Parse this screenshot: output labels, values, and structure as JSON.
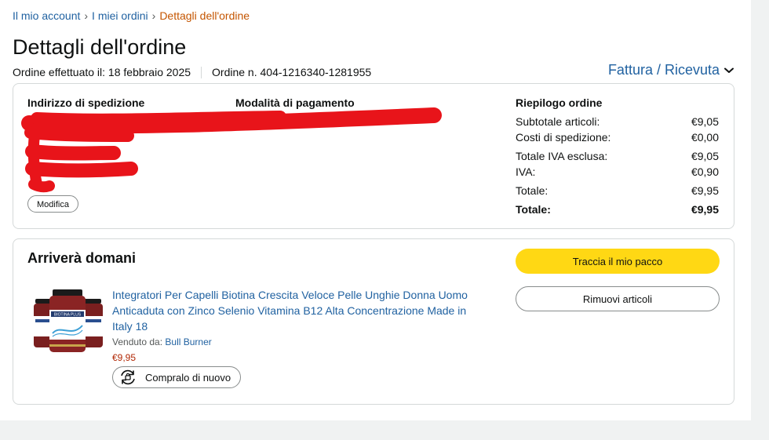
{
  "breadcrumb": {
    "items": [
      "Il mio account",
      "I miei ordini"
    ],
    "current": "Dettagli dell'ordine",
    "separator": "›"
  },
  "page_title": "Dettagli dell'ordine",
  "order_meta": {
    "placed": "Ordine effettuato il: 18 febbraio 2025",
    "number": "Ordine n. 404-1216340-1281955"
  },
  "invoice_link": "Fattura / Ricevuta",
  "summary_card": {
    "shipping_address_heading": "Indirizzo di spedizione",
    "payment_method_heading": "Modalità di pagamento",
    "edit_button": "Modifica",
    "order_summary": {
      "heading": "Riepilogo ordine",
      "rows": [
        {
          "label": "Subtotale articoli:",
          "value": "€9,05"
        },
        {
          "label": "Costi di spedizione:",
          "value": "€0,00"
        },
        {
          "label": "Totale IVA esclusa:",
          "value": "€9,05"
        },
        {
          "label": "IVA:",
          "value": "€0,90"
        },
        {
          "label": "Totale:",
          "value": "€9,95"
        },
        {
          "label": "Totale:",
          "value": "€9,95"
        }
      ]
    }
  },
  "shipment_card": {
    "status": "Arriverà domani",
    "track_button": "Traccia il mio pacco",
    "remove_button": "Rimuovi articoli",
    "product": {
      "title": "Integratori Per Capelli Biotina Crescita Veloce Pelle Unghie Donna Uomo Anticaduta con Zinco Selenio Vitamina B12 Alta Concentrazione Made in Italy 18",
      "sold_by_label": "Venduto da:",
      "seller": "Bull Burner",
      "price": "€9,95",
      "rebuy_button": "Compralo di nuovo",
      "image_label": "BIOTINA PLUS"
    }
  },
  "colors": {
    "link": "#2162a1",
    "breadcrumb_current": "#c45500",
    "primary_button": "#ffd814",
    "price": "#b12704",
    "redaction": "#e8141a"
  },
  "icons": [
    "chevron-down-icon",
    "rebuy-icon"
  ]
}
